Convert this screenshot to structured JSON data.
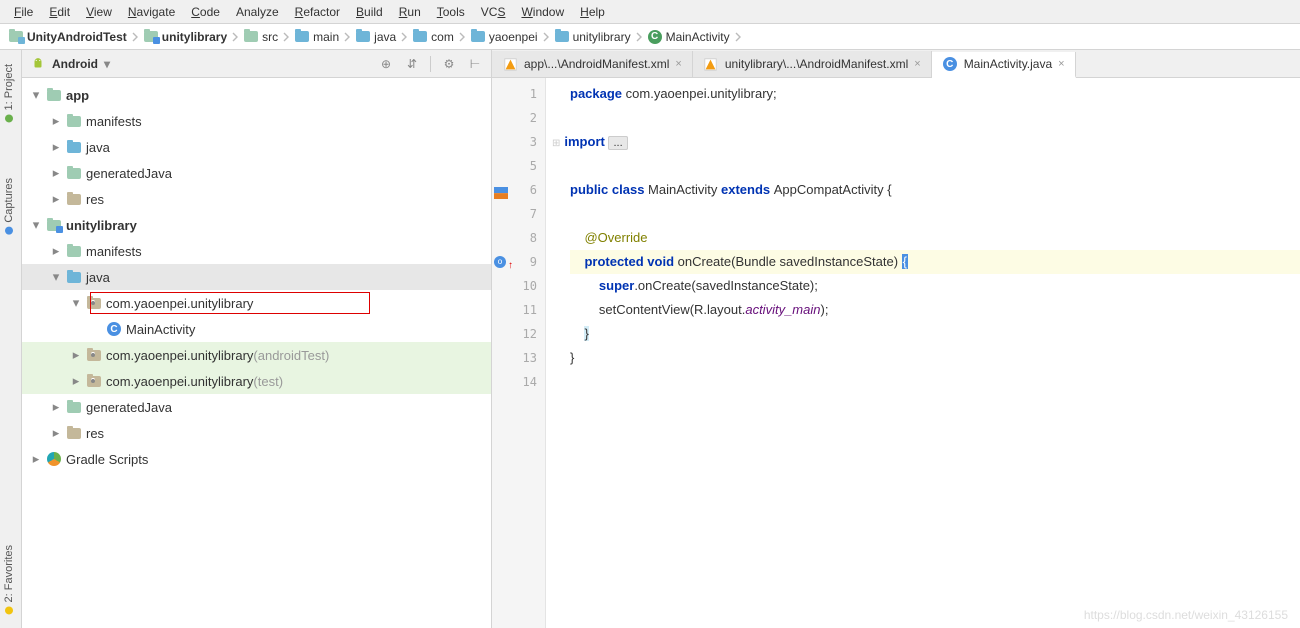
{
  "menu": [
    "File",
    "Edit",
    "View",
    "Navigate",
    "Code",
    "Analyze",
    "Refactor",
    "Build",
    "Run",
    "Tools",
    "VCS",
    "Window",
    "Help"
  ],
  "menu_accel": [
    "F",
    "E",
    "V",
    "N",
    "C",
    "",
    "R",
    "B",
    "R",
    "T",
    "S",
    "W",
    "H"
  ],
  "breadcrumb": [
    {
      "icon": "project",
      "label": "UnityAndroidTest",
      "bold": true
    },
    {
      "icon": "module",
      "label": "unitylibrary",
      "bold": true
    },
    {
      "icon": "folder-teal",
      "label": "src"
    },
    {
      "icon": "folder-blue",
      "label": "main"
    },
    {
      "icon": "folder-blue",
      "label": "java"
    },
    {
      "icon": "folder-blue",
      "label": "com"
    },
    {
      "icon": "folder-blue",
      "label": "yaoenpei"
    },
    {
      "icon": "folder-blue",
      "label": "unitylibrary"
    },
    {
      "icon": "class",
      "label": "MainActivity"
    }
  ],
  "panel": {
    "title": "Android",
    "actions": [
      "target",
      "collapse",
      "divider",
      "gear",
      "hide"
    ]
  },
  "vtabs": {
    "project": "1: Project",
    "captures": "Captures",
    "favorites": "2: Favorites"
  },
  "tree": [
    {
      "depth": 0,
      "arrow": "down",
      "icon": "folder-teal",
      "label": "app",
      "bold": true
    },
    {
      "depth": 1,
      "arrow": "right",
      "icon": "folder-teal",
      "label": "manifests"
    },
    {
      "depth": 1,
      "arrow": "right",
      "icon": "folder-blue",
      "label": "java"
    },
    {
      "depth": 1,
      "arrow": "right",
      "icon": "folder-teal",
      "label": "generatedJava"
    },
    {
      "depth": 1,
      "arrow": "right",
      "icon": "folder-gray",
      "label": "res"
    },
    {
      "depth": 0,
      "arrow": "down",
      "icon": "module",
      "label": "unitylibrary",
      "bold": true
    },
    {
      "depth": 1,
      "arrow": "right",
      "icon": "folder-teal",
      "label": "manifests"
    },
    {
      "depth": 1,
      "arrow": "down",
      "icon": "folder-blue",
      "label": "java",
      "selected": true
    },
    {
      "depth": 2,
      "arrow": "down",
      "icon": "pkg",
      "label": "com.yaoenpei.unitylibrary",
      "boxed": true
    },
    {
      "depth": 3,
      "arrow": "none",
      "icon": "class-blue",
      "label": "MainActivity"
    },
    {
      "depth": 2,
      "arrow": "right",
      "icon": "pkg",
      "label": "com.yaoenpei.unitylibrary",
      "suffix": " (androidTest)",
      "hlg": true
    },
    {
      "depth": 2,
      "arrow": "right",
      "icon": "pkg",
      "label": "com.yaoenpei.unitylibrary",
      "suffix": " (test)",
      "hlg": true
    },
    {
      "depth": 1,
      "arrow": "right",
      "icon": "folder-teal",
      "label": "generatedJava"
    },
    {
      "depth": 1,
      "arrow": "right",
      "icon": "folder-gray",
      "label": "res"
    },
    {
      "depth": 0,
      "arrow": "right",
      "icon": "gradle",
      "label": "Gradle Scripts"
    }
  ],
  "tabs": [
    {
      "icon": "xml-warn",
      "label": "app\\...\\AndroidManifest.xml",
      "active": false
    },
    {
      "icon": "xml-warn",
      "label": "unitylibrary\\...\\AndroidManifest.xml",
      "active": false
    },
    {
      "icon": "class-blue",
      "label": "MainActivity.java",
      "active": true
    }
  ],
  "code": {
    "lines": [
      {
        "n": 1,
        "seg": [
          [
            "kw",
            "package "
          ],
          [
            "",
            "com.yaoenpei.unitylibrary;"
          ]
        ]
      },
      {
        "n": 2,
        "seg": []
      },
      {
        "n": 3,
        "seg": [
          [
            "kw",
            "import "
          ],
          [
            "fold",
            "..."
          ]
        ],
        "fold_before": true
      },
      {
        "n": 5,
        "seg": []
      },
      {
        "n": 6,
        "seg": [
          [
            "kw",
            "public class "
          ],
          [
            "",
            "MainActivity "
          ],
          [
            "kw",
            "extends "
          ],
          [
            "",
            "AppCompatActivity {"
          ]
        ],
        "icon": "warn"
      },
      {
        "n": 7,
        "seg": []
      },
      {
        "n": 8,
        "seg": [
          [
            "",
            "    "
          ],
          [
            "ann",
            "@Override"
          ]
        ]
      },
      {
        "n": 9,
        "seg": [
          [
            "",
            "    "
          ],
          [
            "kw",
            "protected void "
          ],
          [
            "",
            "onCreate(Bundle savedInstanceState) "
          ],
          [
            "cursor",
            "{"
          ]
        ],
        "hl": true,
        "icon": "override"
      },
      {
        "n": 10,
        "seg": [
          [
            "",
            "        "
          ],
          [
            "kw",
            "super"
          ],
          [
            "",
            ".onCreate(savedInstanceState);"
          ]
        ]
      },
      {
        "n": 11,
        "seg": [
          [
            "",
            "        setContentView(R.layout."
          ],
          [
            "par",
            "activity_main"
          ],
          [
            "",
            ");"
          ]
        ]
      },
      {
        "n": 12,
        "seg": [
          [
            "",
            "    "
          ],
          [
            "brace",
            "}"
          ]
        ]
      },
      {
        "n": 13,
        "seg": [
          [
            "",
            "}"
          ]
        ]
      },
      {
        "n": 14,
        "seg": []
      }
    ]
  },
  "watermark": "https://blog.csdn.net/weixin_43126155"
}
